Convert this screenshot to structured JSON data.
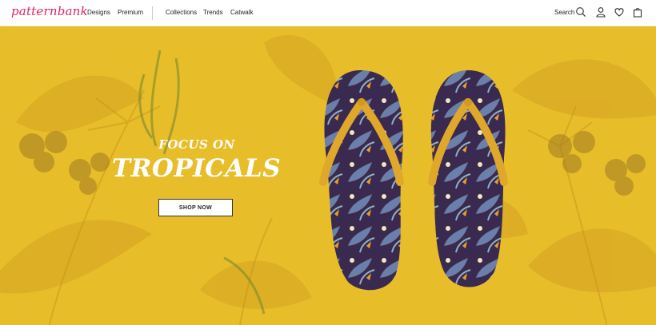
{
  "brand": {
    "logo_text": "patternbank"
  },
  "nav": {
    "primary": [
      "Designs",
      "Premium"
    ],
    "secondary": [
      "Collections",
      "Trends",
      "Catwalk"
    ]
  },
  "header_actions": {
    "search_label": "Search",
    "icons": [
      "search-icon",
      "user-icon",
      "heart-icon",
      "bag-icon"
    ]
  },
  "hero": {
    "kicker": "FOCUS ON",
    "headline": "TROPICALS",
    "cta_label": "SHOP NOW",
    "background_color": "#e8bd2a",
    "strap_color": "#e0a82a",
    "sole_color": "#3a2a4f"
  },
  "colors": {
    "brand": "#e0245e"
  }
}
